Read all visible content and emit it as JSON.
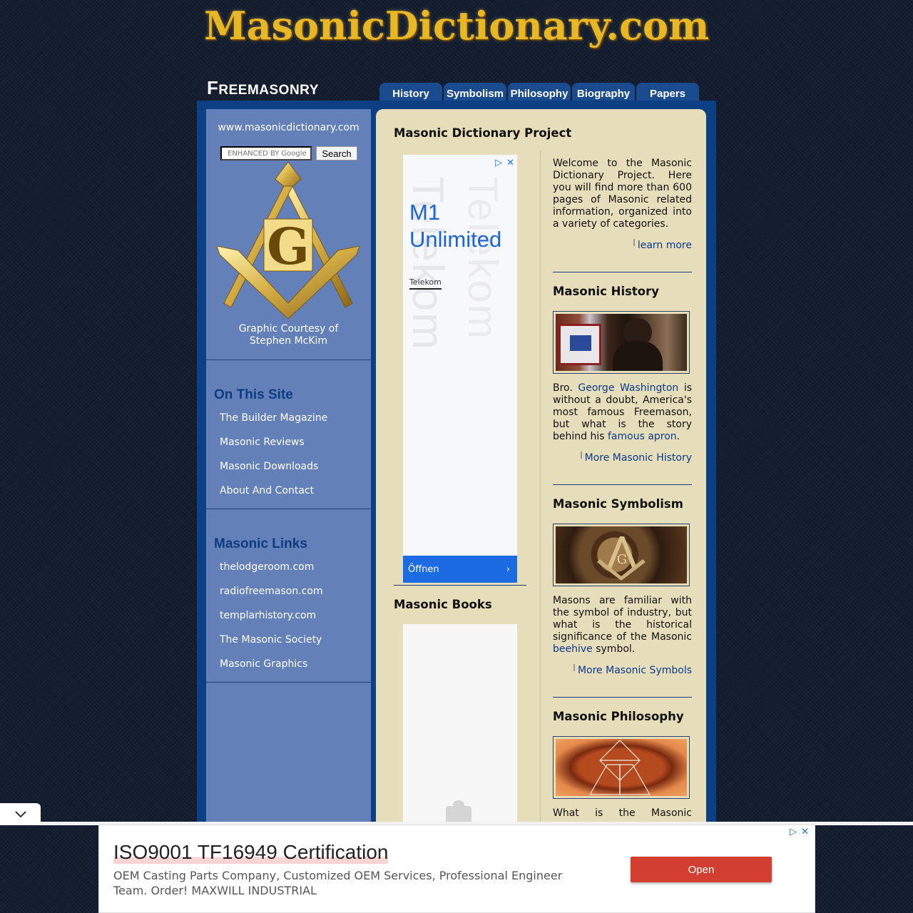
{
  "header": {
    "logo_text": "MasonicDictionary.com",
    "brand_first": "F",
    "brand_rest": "REEMASONRY"
  },
  "tabs": [
    "History",
    "Symbolism",
    "Philosophy",
    "Biography",
    "Papers"
  ],
  "sidebar": {
    "url": "www.masonicdictionary.com",
    "search_placeholder": "ENHANCED BY Google",
    "search_button": "Search",
    "credit_line1": "Graphic Courtesy of",
    "credit_line2": "Stephen McKim",
    "on_this_site": {
      "heading": "On This Site",
      "items": [
        "The Builder Magazine",
        "Masonic Reviews",
        "Masonic Downloads",
        "About And Contact"
      ]
    },
    "masonic_links": {
      "heading": "Masonic Links",
      "items": [
        "thelodgeroom.com",
        "radiofreemason.com",
        "templarhistory.com",
        "The Masonic Society",
        "Masonic Graphics"
      ]
    }
  },
  "main": {
    "title": "Masonic Dictionary Project",
    "ad": {
      "watermark": "Telekom",
      "headline1": "M1",
      "headline2": "Unlimited",
      "brand": "Telekom",
      "cta": "Öffnen"
    },
    "books_title": "Masonic Books",
    "welcome": "Welcome to the Masonic Dictionary Project. Here you will find more than 600 pages of Masonic related information, organized into a variety of categories.",
    "learn_more": "learn more",
    "history": {
      "title": "Masonic History",
      "t1": "Bro. ",
      "l1": "George Washington",
      "t2": " is without a doubt, America's most famous Freemason, but what is the story behind his ",
      "l2": "famous apron",
      "t3": ".",
      "more": "More Masonic History"
    },
    "symbolism": {
      "title": "Masonic Symbolism",
      "t1": "Masons are familiar with the symbol of industry, but what is the historical significance of the Masonic ",
      "l1": "beehive",
      "t2": " symbol.",
      "more": "More Masonic Symbols"
    },
    "philosophy": {
      "title": "Masonic Philosophy",
      "text": "What is the Masonic"
    }
  },
  "bottom_ad": {
    "headline": "ISO9001 TF16949 Certification",
    "body": "OEM Casting Parts Company, Customized OEM Services, Professional Engineer Team. Order! MAXWILL INDUSTRIAL",
    "button": "Open"
  },
  "colors": {
    "frame": "#0d3f85",
    "sidebar": "#6380b8",
    "content": "#e6ddba",
    "tab": "#1b4b8f",
    "logo_gold": "#e8b725",
    "link": "#0b3b8a"
  }
}
